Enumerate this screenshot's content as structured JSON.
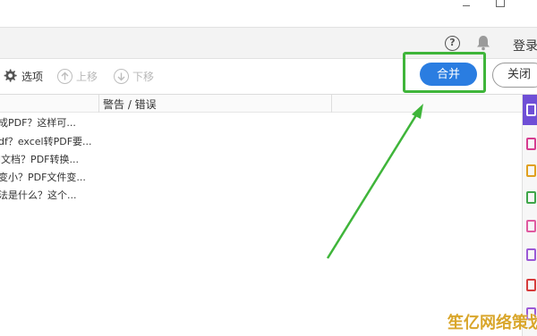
{
  "menubar": {
    "help_icon": "help-circle-icon",
    "bell_icon": "bell-icon",
    "login_label": "登录"
  },
  "toolbar": {
    "options_label": "选项",
    "move_up_label": "上移",
    "move_down_label": "下移",
    "merge_label": "合并",
    "close_label": "关闭"
  },
  "table": {
    "column_warning": "警告 / 错误",
    "rows": [
      "成PDF？这样可...",
      "df？excel转PDF要...",
      "l文档？PDF转换...",
      "变小？PDF文件变...",
      "法是什么？这个..."
    ]
  },
  "rail_colors": [
    "#6f4fd6",
    "#d63c8f",
    "#e0a020",
    "#3fa64a",
    "#e05aa0",
    "#9b59d6",
    "#d63c3c"
  ],
  "highlight_color": "#3fb53a",
  "accent_color": "#2a7de1",
  "watermark": "笙亿网络策划"
}
